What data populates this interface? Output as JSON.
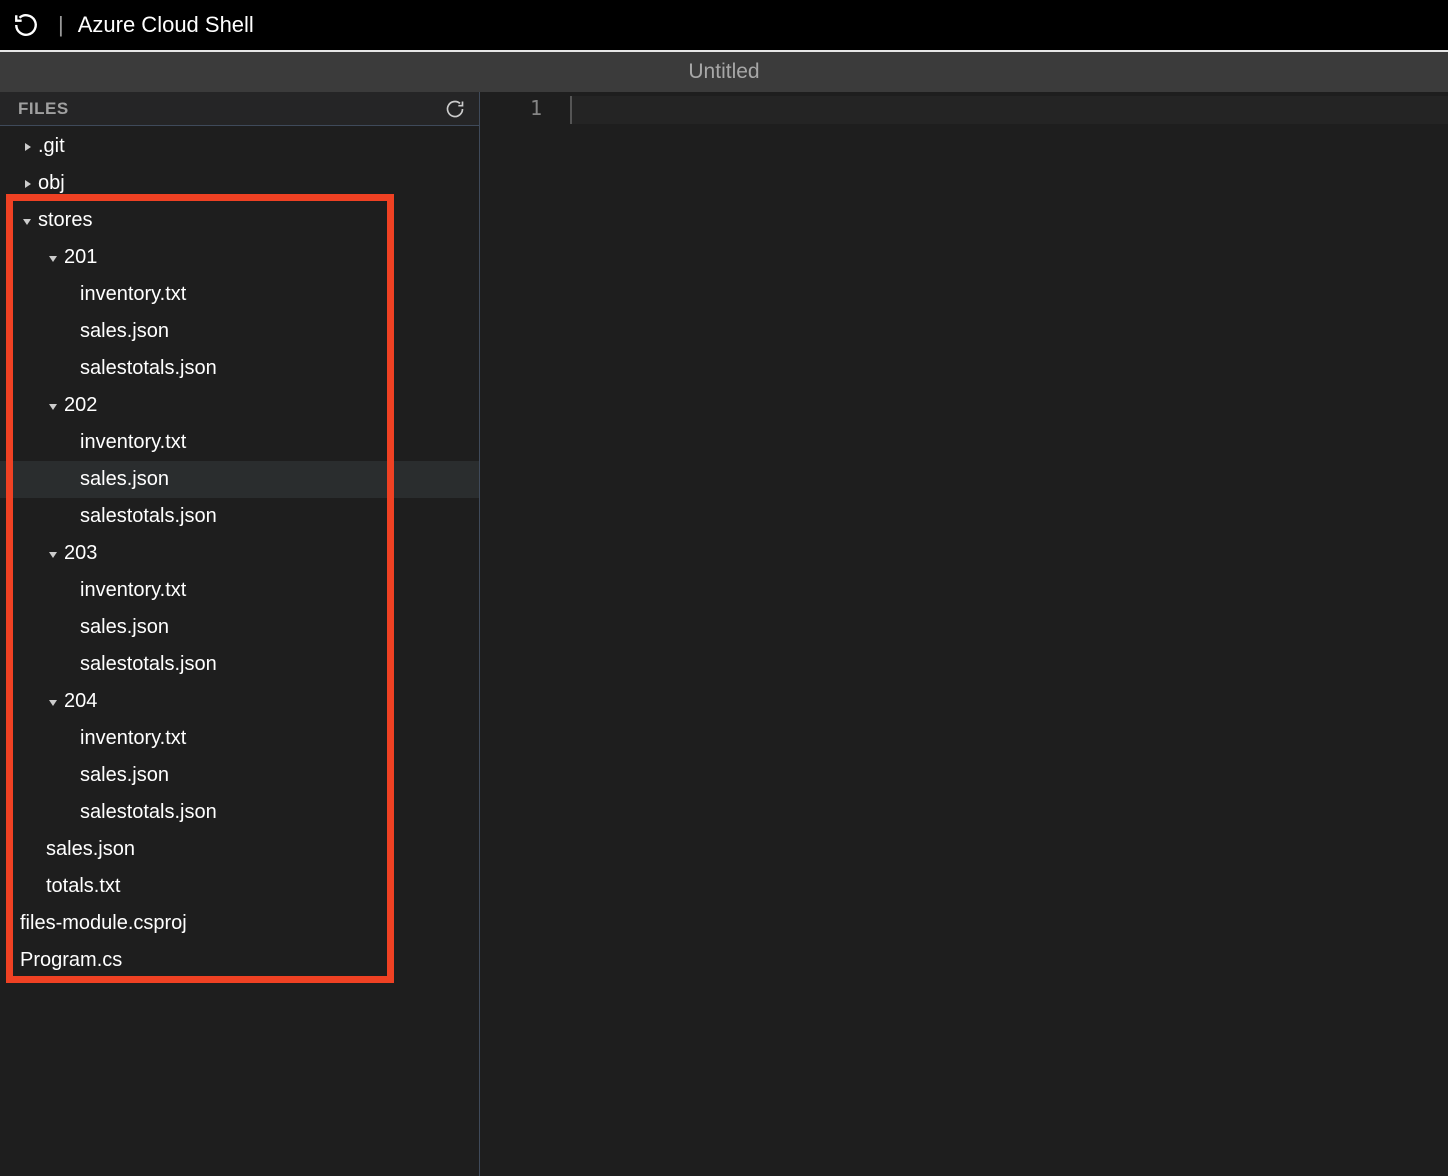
{
  "topbar": {
    "title": "Azure Cloud Shell",
    "divider": "|"
  },
  "tabbar": {
    "title": "Untitled"
  },
  "sidebar": {
    "header": "FILES",
    "tree": [
      {
        "name": ".git",
        "type": "folder",
        "expanded": false,
        "depth": 0
      },
      {
        "name": "obj",
        "type": "folder",
        "expanded": false,
        "depth": 0
      },
      {
        "name": "stores",
        "type": "folder",
        "expanded": true,
        "depth": 0,
        "hlstart": true
      },
      {
        "name": "201",
        "type": "folder",
        "expanded": true,
        "depth": 1
      },
      {
        "name": "inventory.txt",
        "type": "file",
        "depth": 2
      },
      {
        "name": "sales.json",
        "type": "file",
        "depth": 2
      },
      {
        "name": "salestotals.json",
        "type": "file",
        "depth": 2
      },
      {
        "name": "202",
        "type": "folder",
        "expanded": true,
        "depth": 1
      },
      {
        "name": "inventory.txt",
        "type": "file",
        "depth": 2
      },
      {
        "name": "sales.json",
        "type": "file",
        "depth": 2,
        "selected": true
      },
      {
        "name": "salestotals.json",
        "type": "file",
        "depth": 2
      },
      {
        "name": "203",
        "type": "folder",
        "expanded": true,
        "depth": 1
      },
      {
        "name": "inventory.txt",
        "type": "file",
        "depth": 2
      },
      {
        "name": "sales.json",
        "type": "file",
        "depth": 2
      },
      {
        "name": "salestotals.json",
        "type": "file",
        "depth": 2
      },
      {
        "name": "204",
        "type": "folder",
        "expanded": true,
        "depth": 1
      },
      {
        "name": "inventory.txt",
        "type": "file",
        "depth": 2
      },
      {
        "name": "sales.json",
        "type": "file",
        "depth": 2
      },
      {
        "name": "salestotals.json",
        "type": "file",
        "depth": 2
      },
      {
        "name": "sales.json",
        "type": "file",
        "depth": 1
      },
      {
        "name": "totals.txt",
        "type": "file",
        "depth": 1
      },
      {
        "name": "files-module.csproj",
        "type": "file",
        "depth": 0
      },
      {
        "name": "Program.cs",
        "type": "file",
        "depth": 0,
        "hlend": true
      }
    ]
  },
  "editor": {
    "line_numbers": [
      "1"
    ]
  }
}
